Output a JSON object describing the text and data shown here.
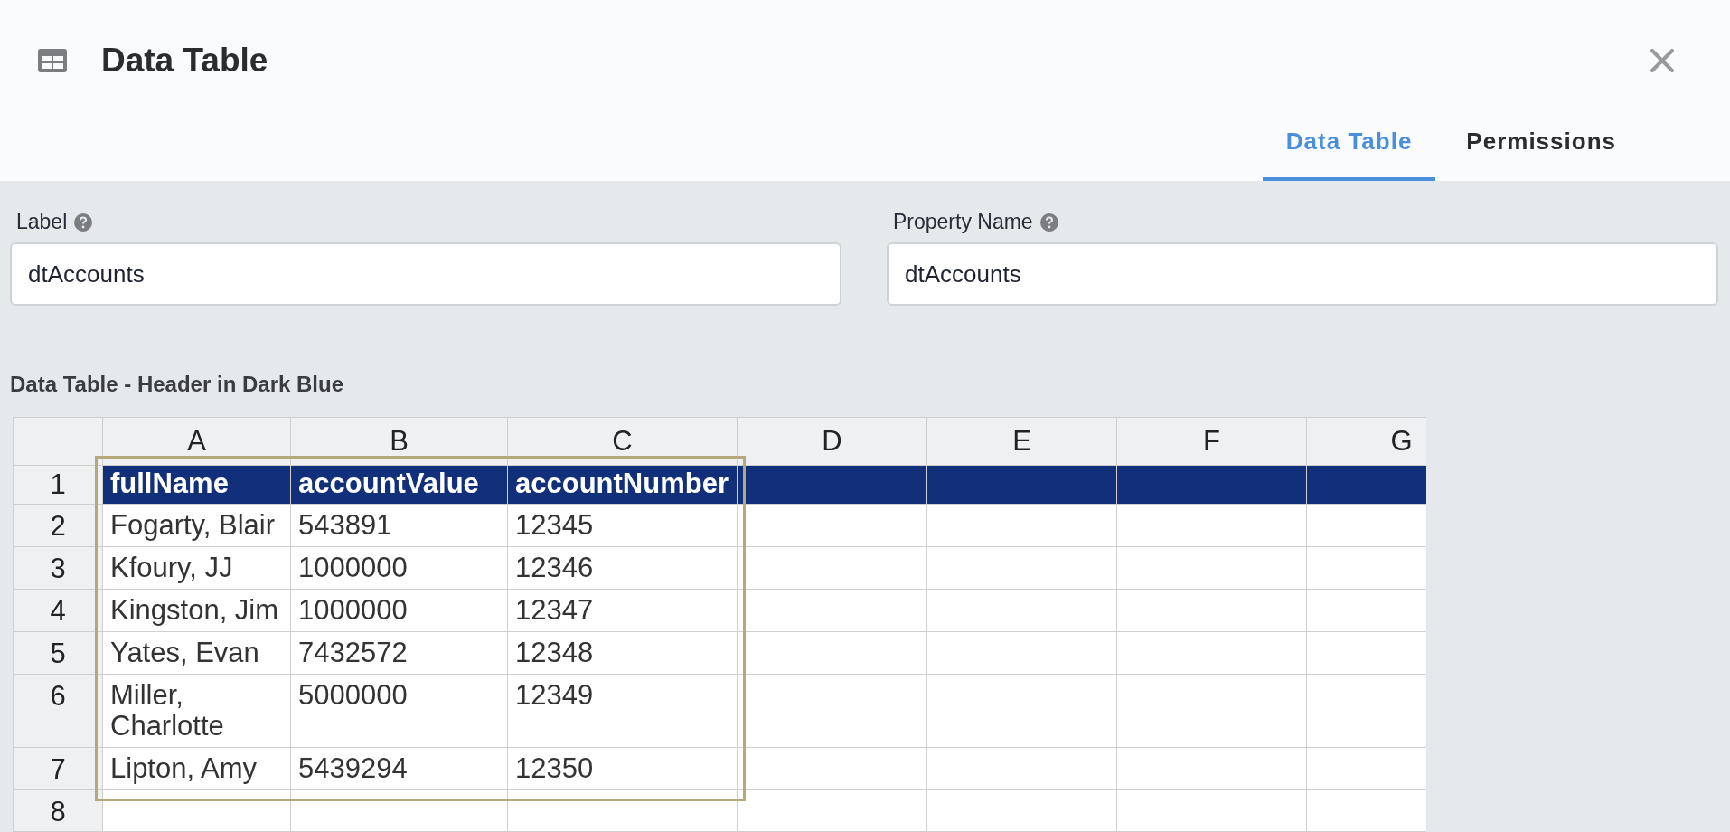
{
  "dialog": {
    "title": "Data Table"
  },
  "tabs": [
    {
      "label": "Data Table",
      "selected": true
    },
    {
      "label": "Permissions",
      "selected": false
    }
  ],
  "fields": [
    {
      "label": "Label",
      "value": "dtAccounts"
    },
    {
      "label": "Property Name",
      "value": "dtAccounts"
    }
  ],
  "table": {
    "title": "Data Table - Header in Dark Blue",
    "columns": [
      "A",
      "B",
      "C",
      "D",
      "E",
      "F",
      "G"
    ],
    "rows": [
      {
        "number": "1",
        "kind": "header",
        "cells": [
          "fullName",
          "accountValue",
          "accountNumber"
        ]
      },
      {
        "number": "2",
        "kind": "data",
        "cells": [
          "Fogarty, Blair",
          "543891",
          "12345"
        ]
      },
      {
        "number": "3",
        "kind": "data",
        "cells": [
          "Kfoury, JJ",
          "1000000",
          "12346"
        ]
      },
      {
        "number": "4",
        "kind": "data",
        "cells": [
          "Kingston, Jim",
          "1000000",
          "12347"
        ]
      },
      {
        "number": "5",
        "kind": "data",
        "cells": [
          "Yates, Evan",
          "7432572",
          "12348"
        ]
      },
      {
        "number": "6",
        "kind": "data",
        "cells": [
          "Miller, Charlotte",
          "5000000",
          "12349"
        ]
      },
      {
        "number": "7",
        "kind": "data",
        "cells": [
          "Lipton, Amy",
          "5439294",
          "12350"
        ]
      },
      {
        "number": "8",
        "kind": "data"
      }
    ]
  }
}
